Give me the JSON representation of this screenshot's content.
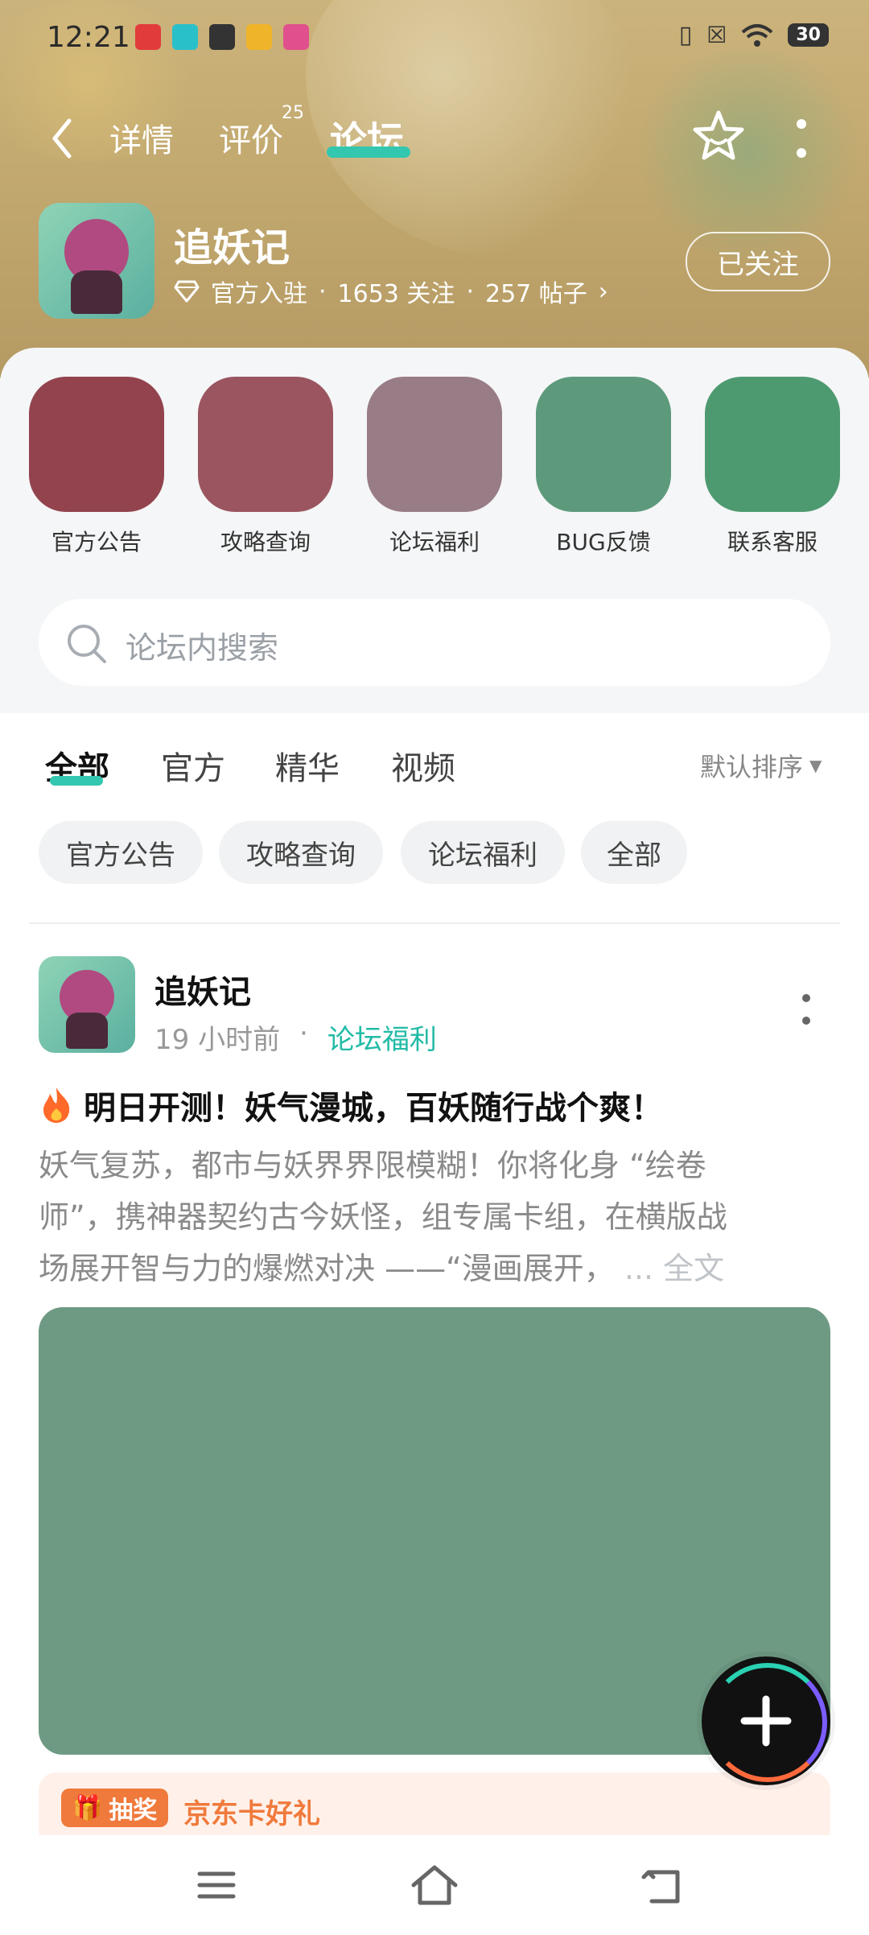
{
  "status_bar": {
    "time": "12:21",
    "battery": "30",
    "notif_icon_names": [
      "app-notif-icon",
      "top-notif-icon",
      "chat-notif-icon",
      "weibo-notif-icon",
      "video-notif-icon"
    ]
  },
  "nav": {
    "back_icon": "chevron-left-icon",
    "tabs": [
      {
        "label": "详情"
      },
      {
        "label": "评价",
        "badge": "25"
      },
      {
        "label": "论坛"
      }
    ],
    "active_tab": 2,
    "star_icon": "star-outline-icon",
    "more_icon": "more-vertical-icon"
  },
  "game": {
    "name": "追妖记",
    "official": "官方入驻",
    "followers": "1653 关注",
    "posts": "257 帖子",
    "follow_button": "已关注"
  },
  "quick_links": [
    {
      "label": "官方公告",
      "color": "#92434d"
    },
    {
      "label": "攻略查询",
      "color": "#9a5561"
    },
    {
      "label": "论坛福利",
      "color": "#987c86"
    },
    {
      "label": "BUG反馈",
      "color": "#5d9a7c"
    },
    {
      "label": "联系客服",
      "color": "#4e9a70"
    }
  ],
  "search": {
    "placeholder": "论坛内搜索"
  },
  "filter_tabs": [
    {
      "label": "全部"
    },
    {
      "label": "官方"
    },
    {
      "label": "精华"
    },
    {
      "label": "视频"
    }
  ],
  "sort": {
    "label": "默认排序"
  },
  "chips": [
    {
      "label": "官方公告"
    },
    {
      "label": "攻略查询"
    },
    {
      "label": "论坛福利"
    },
    {
      "label": "全部"
    }
  ],
  "post": {
    "author": "追妖记",
    "time": "19 小时前",
    "category": "论坛福利",
    "title": "明日开测！妖气漫城，百妖随行战个爽！",
    "excerpt_lines": [
      "妖气复苏，都市与妖界界限模糊！你将化身 “绘卷",
      "师”，携神器契约古今妖怪，组专属卡组，在横版战",
      "场展开智与力的爆燃对决 ——“漫画展开， "
    ],
    "more_text": "... 全文",
    "image_color": "#6e9a83",
    "promo_badge": "抽奖",
    "promo_text": "京东卡好礼"
  },
  "colors": {
    "accent": "#22bba6",
    "promo": "#f07a3c"
  }
}
